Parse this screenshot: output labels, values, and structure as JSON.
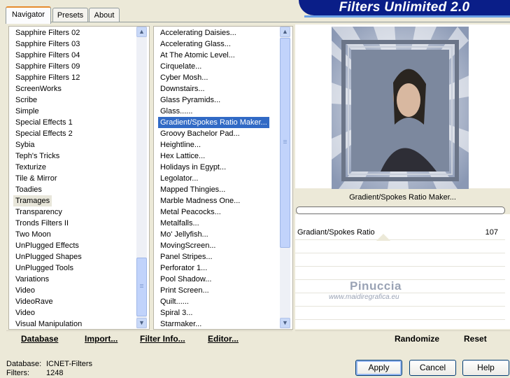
{
  "tabs": [
    "Navigator",
    "Presets",
    "About"
  ],
  "banner_title": "Filters Unlimited 2.0",
  "categories": [
    "Sapphire Filters 02",
    "Sapphire Filters 03",
    "Sapphire Filters 04",
    "Sapphire Filters 09",
    "Sapphire Filters 12",
    "ScreenWorks",
    "Scribe",
    "Simple",
    "Special Effects 1",
    "Special Effects 2",
    "Sybia",
    "Teph's Tricks",
    "Texturize",
    "Tile & Mirror",
    "Toadies",
    "Tramages",
    "Transparency",
    "Tronds Filters II",
    "Two Moon",
    "UnPlugged Effects",
    "UnPlugged Shapes",
    "UnPlugged Tools",
    "Variations",
    "Video",
    "VideoRave",
    "Video",
    "Visual Manipulation"
  ],
  "selected_category": "Tramages",
  "filters": [
    "Accelerating Daisies...",
    "Accelerating Glass...",
    "At The Atomic Level...",
    "Cirquelate...",
    "Cyber Mosh...",
    "Downstairs...",
    "Glass Pyramids...",
    "Glass......",
    "Gradient/Spokes Ratio Maker...",
    "Groovy Bachelor Pad...",
    "Heightline...",
    "Hex Lattice...",
    "Holidays in Egypt...",
    "Legolator...",
    "Mapped Thingies...",
    "Marble Madness One...",
    "Metal Peacocks...",
    "Metalfalls...",
    "Mo' Jellyfish...",
    "MovingScreen...",
    "Panel Stripes...",
    "Perforator 1...",
    "Pool Shadow...",
    "Print Screen...",
    "Quilt......",
    "Spiral 3...",
    "Starmaker..."
  ],
  "selected_filter": "Gradient/Spokes Ratio Maker...",
  "left_toolbar": {
    "database": "Database",
    "import": "Import...",
    "filter_info": "Filter Info...",
    "editor": "Editor..."
  },
  "right_toolbar": {
    "randomize": "Randomize",
    "reset": "Reset"
  },
  "filter_name": "Gradient/Spokes Ratio Maker...",
  "parameter": {
    "label": "Gradiant/Spokes Ratio",
    "value": "107"
  },
  "watermark": {
    "name": "Pinuccia",
    "url": "www.maidiregrafica.eu"
  },
  "footer": {
    "database_label": "Database:",
    "database_value": "ICNET-Filters",
    "filters_label": "Filters:",
    "filters_value": "1248"
  },
  "buttons": {
    "apply": "Apply",
    "cancel": "Cancel",
    "help": "Help"
  },
  "colors": {
    "selection": "#316ac5",
    "banner": "#0a1e88",
    "tab_accent": "#e68b2c"
  }
}
